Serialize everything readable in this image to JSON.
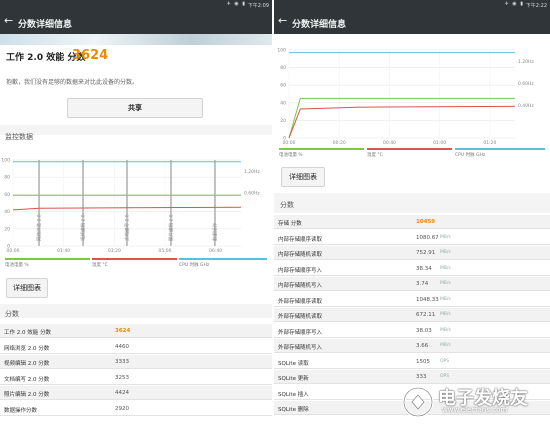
{
  "left": {
    "status_time": "下午2:09",
    "header_title": "分数详细信息",
    "score_title": "工作 2.0 效能 分数",
    "score_value": "3624",
    "score_note": "抱歉，我们没有足够的数据来对比此设备的分数。",
    "share_label": "共享",
    "monitor_title": "监控数据",
    "detail_chart_label": "详细图表",
    "scores_title": "分数",
    "chart_data": {
      "type": "line",
      "x_ticks": [
        "00:00",
        "01:40",
        "03:20",
        "05:00",
        "06:40"
      ],
      "y_ticks": [
        "100",
        "80",
        "60",
        "40",
        "20",
        "0"
      ],
      "y_right_ticks": [
        "1.20Hz",
        "0.60Hz"
      ],
      "ylim": [
        0,
        100
      ],
      "series": [
        {
          "name": "电池电量 %",
          "color": "#7ac943",
          "points": [
            [
              0,
              59
            ],
            [
              1,
              59
            ],
            [
              7,
              59
            ]
          ]
        },
        {
          "name": "温度 °C",
          "color": "#d9534f",
          "points": [
            [
              0,
              42
            ],
            [
              0.8,
              44
            ],
            [
              7,
              45
            ]
          ]
        },
        {
          "name": "CPU 时脉 GHz",
          "color": "#5bc0de",
          "points": [
            [
              0,
              98
            ],
            [
              7,
              98
            ]
          ]
        }
      ],
      "phase_markers": [
        0.8,
        2.15,
        3.5,
        4.85,
        6.2
      ],
      "phase_labels": [
        "网络浏览 2.0",
        "视频编辑 2.0",
        "文档编写 2.0",
        "照片编辑 2.0",
        "数据操作"
      ]
    },
    "rows": [
      {
        "name": "工作 2.0 效能 分数",
        "value": "3624",
        "highlight": true
      },
      {
        "name": "网络浏览 2.0 分数",
        "value": "4460",
        "highlight": false
      },
      {
        "name": "视频编辑 2.0 分数",
        "value": "3333",
        "highlight": false
      },
      {
        "name": "文档编写 2.0 分数",
        "value": "3253",
        "highlight": false
      },
      {
        "name": "照片编辑 2.0 分数",
        "value": "4424",
        "highlight": false
      },
      {
        "name": "数据操作分数",
        "value": "2920",
        "highlight": false
      }
    ]
  },
  "right": {
    "status_time": "下午2:22",
    "header_title": "分数详细信息",
    "detail_chart_label": "详细图表",
    "scores_title": "分数",
    "chart_data": {
      "type": "line",
      "x_ticks": [
        "00:00",
        "00:20",
        "00:40",
        "01:00",
        "01:20"
      ],
      "y_ticks": [
        "100",
        "80",
        "60",
        "40",
        "20",
        "0"
      ],
      "y_right_ticks": [
        "1.20Hz",
        "0.60Hz",
        "0.40Hz"
      ],
      "ylim": [
        0,
        100
      ],
      "series": [
        {
          "name": "电池电量 %",
          "color": "#7ac943",
          "points": [
            [
              0,
              0
            ],
            [
              0.05,
              45
            ],
            [
              1,
              45
            ]
          ]
        },
        {
          "name": "温度 °C",
          "color": "#d9534f",
          "points": [
            [
              0,
              0
            ],
            [
              0.05,
              33
            ],
            [
              0.3,
              35
            ],
            [
              1,
              36
            ]
          ]
        },
        {
          "name": "CPU 时脉 GHz",
          "color": "#5bc0de",
          "points": [
            [
              0,
              97
            ],
            [
              1,
              97
            ]
          ]
        }
      ]
    },
    "rows": [
      {
        "name": "存储 分数",
        "value": "10459",
        "unit": "",
        "highlight": true
      },
      {
        "name": "内部存储顺序读取",
        "value": "1080.67",
        "unit": "MB/s",
        "highlight": false
      },
      {
        "name": "内部存储随机读取",
        "value": "752.91",
        "unit": "MB/s",
        "highlight": false
      },
      {
        "name": "内部存储顺序写入",
        "value": "38.34",
        "unit": "MB/s",
        "highlight": false
      },
      {
        "name": "内部存储随机写入",
        "value": "3.74",
        "unit": "MB/s",
        "highlight": false
      },
      {
        "name": "外部存储顺序读取",
        "value": "1048.33",
        "unit": "MB/s",
        "highlight": false
      },
      {
        "name": "外部存储随机读取",
        "value": "672.11",
        "unit": "MB/s",
        "highlight": false
      },
      {
        "name": "外部存储顺序写入",
        "value": "38.03",
        "unit": "MB/s",
        "highlight": false
      },
      {
        "name": "外部存储随机写入",
        "value": "3.66",
        "unit": "MB/s",
        "highlight": false
      },
      {
        "name": "SQLite 读取",
        "value": "1505",
        "unit": "OPS",
        "highlight": false
      },
      {
        "name": "SQLite 更新",
        "value": "333",
        "unit": "OPS",
        "highlight": false
      },
      {
        "name": "SQLite 插入",
        "value": "",
        "unit": "",
        "highlight": false
      },
      {
        "name": "SQLite 删除",
        "value": "",
        "unit": "",
        "highlight": false
      }
    ]
  },
  "watermark": {
    "name": "电子发烧友",
    "url": "www.elecfans.com"
  }
}
